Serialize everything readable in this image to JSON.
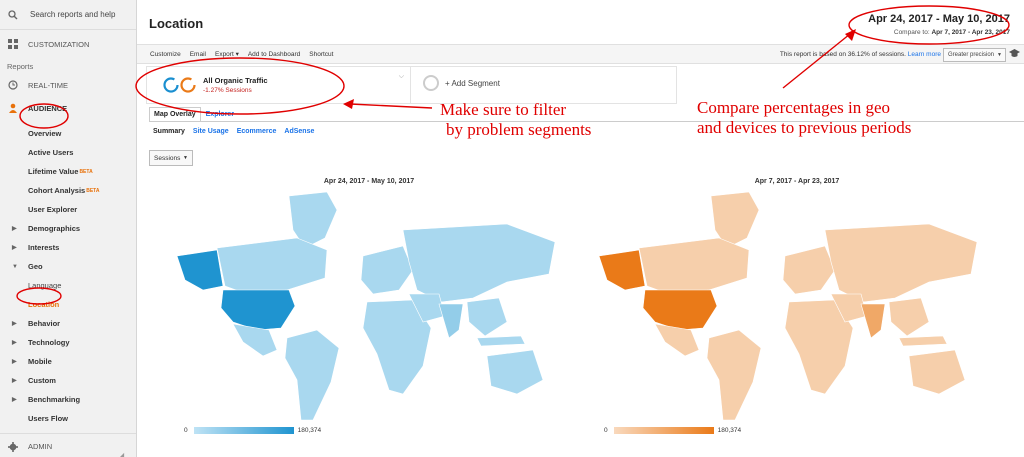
{
  "sidebar": {
    "search_placeholder": "Search reports and help",
    "customization": "CUSTOMIZATION",
    "reports_label": "Reports",
    "realtime": "REAL-TIME",
    "audience": "AUDIENCE",
    "audience_items": [
      {
        "label": "Overview",
        "beta": ""
      },
      {
        "label": "Active Users",
        "beta": ""
      },
      {
        "label": "Lifetime Value",
        "beta": "BETA"
      },
      {
        "label": "Cohort Analysis",
        "beta": "BETA"
      },
      {
        "label": "User Explorer",
        "beta": ""
      }
    ],
    "demographics": "Demographics",
    "interests": "Interests",
    "geo": "Geo",
    "language": "Language",
    "location": "Location",
    "behavior": "Behavior",
    "technology": "Technology",
    "mobile": "Mobile",
    "custom": "Custom",
    "benchmarking": "Benchmarking",
    "users_flow": "Users Flow",
    "admin": "ADMIN"
  },
  "header": {
    "title": "Location",
    "date_range": "Apr 24, 2017 - May 10, 2017",
    "compare_label": "Compare to:",
    "compare_range": "Apr 7, 2017 - Apr 23, 2017"
  },
  "toolbar": {
    "customize": "Customize",
    "email": "Email",
    "export": "Export ▾",
    "add_to_dashboard": "Add to Dashboard",
    "shortcut": "Shortcut",
    "sampling_note": "This report is based on 36.12% of sessions.",
    "learn_more": "Learn more",
    "precision": "Greater precision"
  },
  "segments": {
    "name": "All Organic Traffic",
    "change": "-1.27% Sessions",
    "add": "+ Add Segment"
  },
  "tabs": {
    "map_overlay": "Map Overlay",
    "explorer": "Explorer",
    "summary": "Summary",
    "site_usage": "Site Usage",
    "ecommerce": "Ecommerce",
    "adsense": "AdSense",
    "metric": "Sessions"
  },
  "maps": {
    "current": {
      "title": "Apr 24, 2017 - May 10, 2017",
      "min": "0",
      "max": "180,374",
      "color_low": "#bfe3f5",
      "color_high": "#1f94d0"
    },
    "previous": {
      "title": "Apr 7, 2017 - Apr 23, 2017",
      "min": "0",
      "max": "180,374",
      "color_low": "#f9d9bd",
      "color_high": "#ea7a18"
    }
  },
  "annotations": {
    "filter_line1": "Make sure to filter",
    "filter_line2": "by problem segments",
    "compare_line1": "Compare percentages in geo",
    "compare_line2": "and devices to previous periods",
    "color": "#e00000"
  }
}
